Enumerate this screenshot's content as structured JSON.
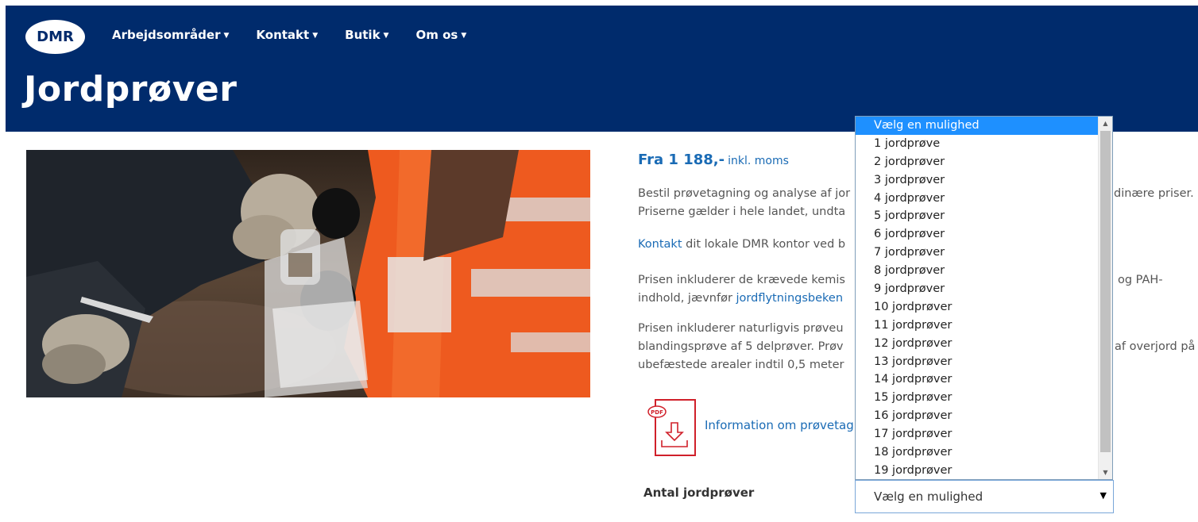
{
  "header": {
    "logo_text": "DMR",
    "nav": [
      {
        "label": "Arbejdsområder"
      },
      {
        "label": "Kontakt"
      },
      {
        "label": "Butik"
      },
      {
        "label": "Om os"
      }
    ],
    "page_title": "Jordprøver"
  },
  "content": {
    "price_main": "Fra 1 188,-",
    "price_note": "inkl. moms",
    "para1": {
      "line1": "Bestil prøvetagning og analyse af jor",
      "line1_tail": "dinære priser.",
      "line2": "Priserne gælder i hele landet, undta"
    },
    "para2": {
      "link": "Kontakt",
      "text": " dit lokale DMR kontor ved b"
    },
    "para3": {
      "line1": "Prisen inkluderer de krævede kemis",
      "line1_tail": "og PAH-",
      "line2_text": "indhold, jævnfør ",
      "line2_link": "jordflytningsbeken"
    },
    "para4": {
      "line1": "Prisen inkluderer naturligvis prøveu",
      "line2": "blandingsprøve af 5 delprøver. Prøv",
      "line2_tail": "af overjord på",
      "line3": "ubefæstede arealer indtil 0,5 meter"
    },
    "pdf_icon_label": "PDF",
    "pdf_link": "Information om prøvetag",
    "qty_label": "Antal jordprøver"
  },
  "select": {
    "value": "Vælg en mulighed",
    "options": [
      "Vælg en mulighed",
      "1 jordprøve",
      "2 jordprøver",
      "3 jordprøver",
      "4 jordprøver",
      "5 jordprøver",
      "6 jordprøver",
      "7 jordprøver",
      "8 jordprøver",
      "9 jordprøver",
      "10 jordprøver",
      "11 jordprøver",
      "12 jordprøver",
      "13 jordprøver",
      "14 jordprøver",
      "15 jordprøver",
      "16 jordprøver",
      "17 jordprøver",
      "18 jordprøver",
      "19 jordprøver"
    ],
    "highlighted_index": 0
  },
  "colors": {
    "header_bg": "#002b6c",
    "link": "#1a6bb5",
    "option_highlight": "#1e90ff",
    "pdf_red": "#d0202a"
  }
}
